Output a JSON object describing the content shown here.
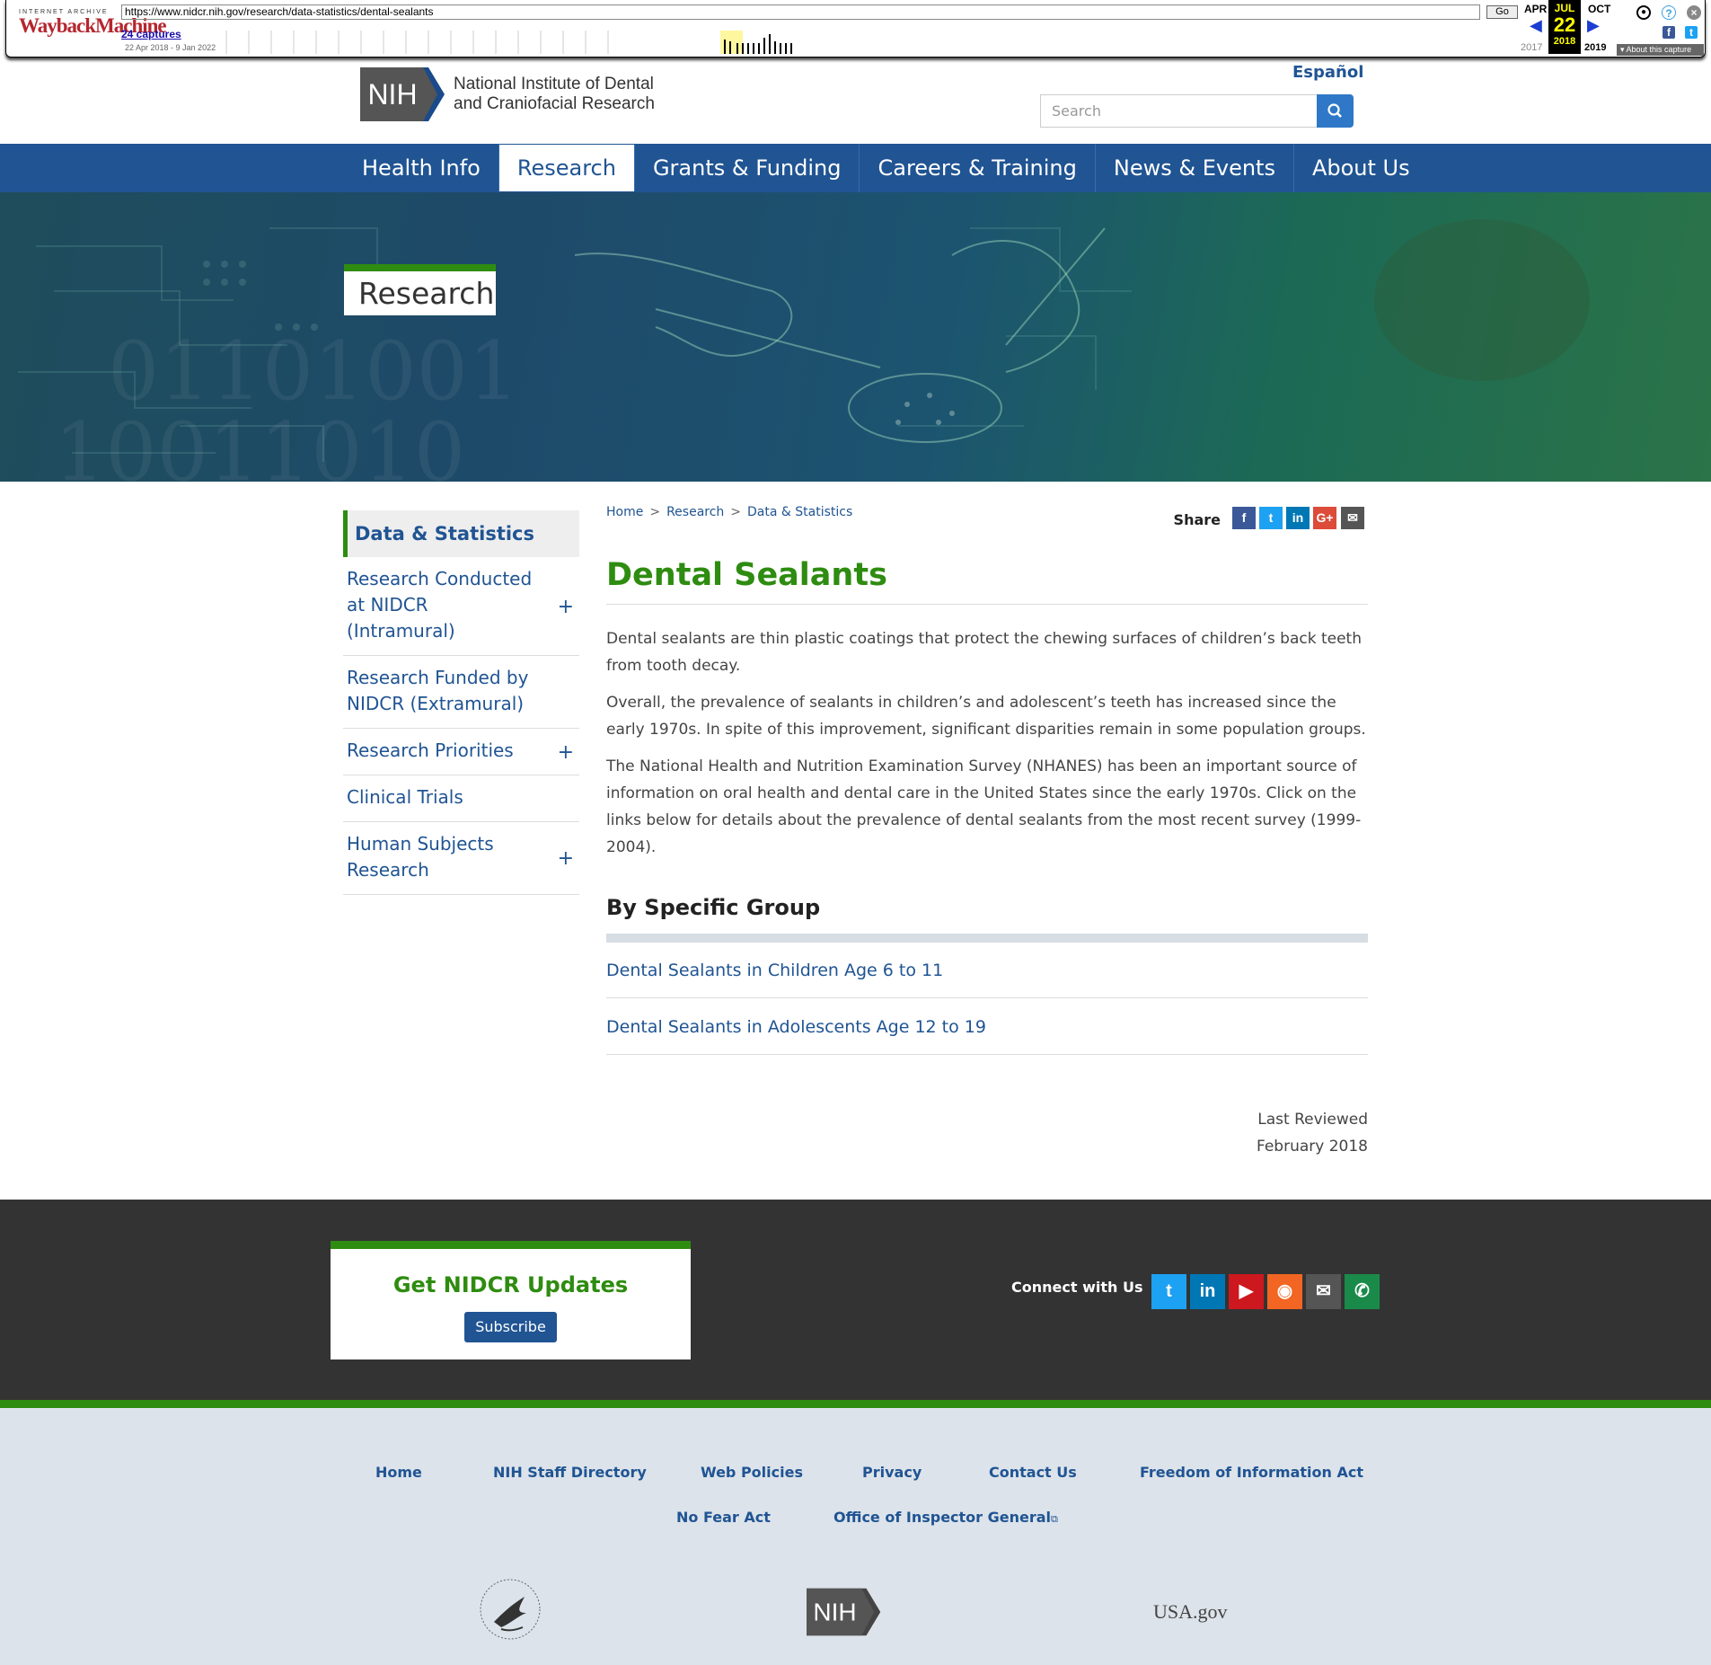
{
  "wayback": {
    "logo_top": "INTERNET ARCHIVE",
    "logo_main": "WaybackMachine",
    "url": "https://www.nidcr.nih.gov/research/data-statistics/dental-sealants",
    "go_label": "Go",
    "captures": "24 captures",
    "range": "22 Apr 2018 - 9 Jan 2022",
    "prev_month": "APR",
    "cur_month": "JUL",
    "next_month": "OCT",
    "day": "22",
    "prev_year": "2017",
    "cur_year": "2018",
    "next_year": "2019",
    "about": "About this capture",
    "icons": [
      "user-icon",
      "help-icon",
      "close-icon",
      "facebook-icon",
      "twitter-icon"
    ]
  },
  "header": {
    "logo_text": "NIH",
    "institute_line1": "National Institute of Dental",
    "institute_line2": "and Craniofacial Research",
    "language_link": "Español",
    "search_placeholder": "Search"
  },
  "nav": {
    "items": [
      "Health Info",
      "Research",
      "Grants & Funding",
      "Careers & Training",
      "News & Events",
      "About Us"
    ],
    "active": "Research"
  },
  "hero": {
    "label": "Research"
  },
  "sidebar": {
    "heading": "Data & Statistics",
    "items": [
      {
        "label": "Research Conducted at NIDCR (Intramural)",
        "expand": "+"
      },
      {
        "label": "Research Funded by NIDCR (Extramural)",
        "expand": ""
      },
      {
        "label": "Research Priorities",
        "expand": "+"
      },
      {
        "label": "Clinical Trials",
        "expand": ""
      },
      {
        "label": "Human Subjects Research",
        "expand": "+"
      }
    ]
  },
  "breadcrumb": {
    "home": "Home",
    "sep": ">",
    "research": "Research",
    "current": "Data & Statistics"
  },
  "share": {
    "label": "Share",
    "buttons": [
      {
        "icon": "facebook-icon",
        "glyph": "f",
        "color": "#3b5998"
      },
      {
        "icon": "twitter-icon",
        "glyph": "t",
        "color": "#1da1f2"
      },
      {
        "icon": "linkedin-icon",
        "glyph": "in",
        "color": "#0077b5"
      },
      {
        "icon": "google-plus-icon",
        "glyph": "G+",
        "color": "#dd4b39"
      },
      {
        "icon": "email-icon",
        "glyph": "✉",
        "color": "#555555"
      }
    ]
  },
  "content": {
    "title": "Dental Sealants",
    "p1": "Dental sealants are thin plastic coatings that protect the chewing surfaces of children’s back teeth from tooth decay.",
    "p2": "Overall, the prevalence of sealants in children’s and adolescent’s teeth has increased since the early 1970s. In spite of this improvement, significant disparities remain in some population groups.",
    "p3": "The National Health and Nutrition Examination Survey (NHANES) has been an important source of information on oral health and dental care in the United States since the early 1970s. Click on the links below for details about the prevalence of dental sealants from the most recent survey (1999-2004).",
    "group_heading": "By Specific Group",
    "links": [
      "Dental Sealants in Children Age 6 to 11",
      "Dental Sealants in Adolescents Age 12 to 19"
    ],
    "reviewed_label": "Last Reviewed",
    "reviewed_date": "February 2018"
  },
  "footer": {
    "updates_heading": "Get NIDCR Updates",
    "subscribe": "Subscribe",
    "connect": "Connect with Us",
    "social": [
      {
        "icon": "twitter-icon",
        "glyph": "t",
        "color": "#1da1f2"
      },
      {
        "icon": "linkedin-icon",
        "glyph": "in",
        "color": "#0077b5"
      },
      {
        "icon": "youtube-icon",
        "glyph": "▶",
        "color": "#cc181e"
      },
      {
        "icon": "rss-icon",
        "glyph": "◉",
        "color": "#f26522"
      },
      {
        "icon": "email-icon",
        "glyph": "✉",
        "color": "#555555"
      },
      {
        "icon": "phone-icon",
        "glyph": "✆",
        "color": "#1a8a4a"
      }
    ],
    "links_row1": [
      "Home",
      "NIH Staff Directory",
      "Web Policies",
      "Privacy",
      "Contact Us",
      "Freedom of Information Act"
    ],
    "links_row2": [
      "No Fear Act",
      "Office of Inspector General"
    ],
    "external_mark": "⧉",
    "nih_logo_text": "NIH",
    "usa_logo_text": "USA.gov"
  },
  "colors": {
    "nav_blue": "#205493",
    "accent_green": "#2e8c10",
    "footer_dark": "#333333",
    "footer_light": "#dce3ea"
  }
}
